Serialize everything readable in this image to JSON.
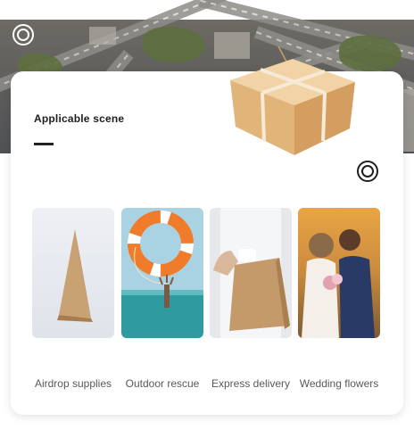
{
  "section": {
    "heading": "Applicable scene"
  },
  "scenes": [
    {
      "label": "Airdrop supplies",
      "image": "paper-bag-illustration"
    },
    {
      "label": "Outdoor rescue",
      "image": "lifebuoy-rescue-photo"
    },
    {
      "label": "Express delivery",
      "image": "delivery-bag-photo"
    },
    {
      "label": "Wedding flowers",
      "image": "wedding-couple-photo"
    }
  ],
  "decorations": {
    "banner_image": "aerial-highway-photo",
    "product_image": "kraft-paper-box",
    "accent_ring_icon": "concentric-ring-icon"
  },
  "colors": {
    "card_background": "#ffffff",
    "heading_text": "#1e1e1e",
    "caption_text": "#595959"
  }
}
